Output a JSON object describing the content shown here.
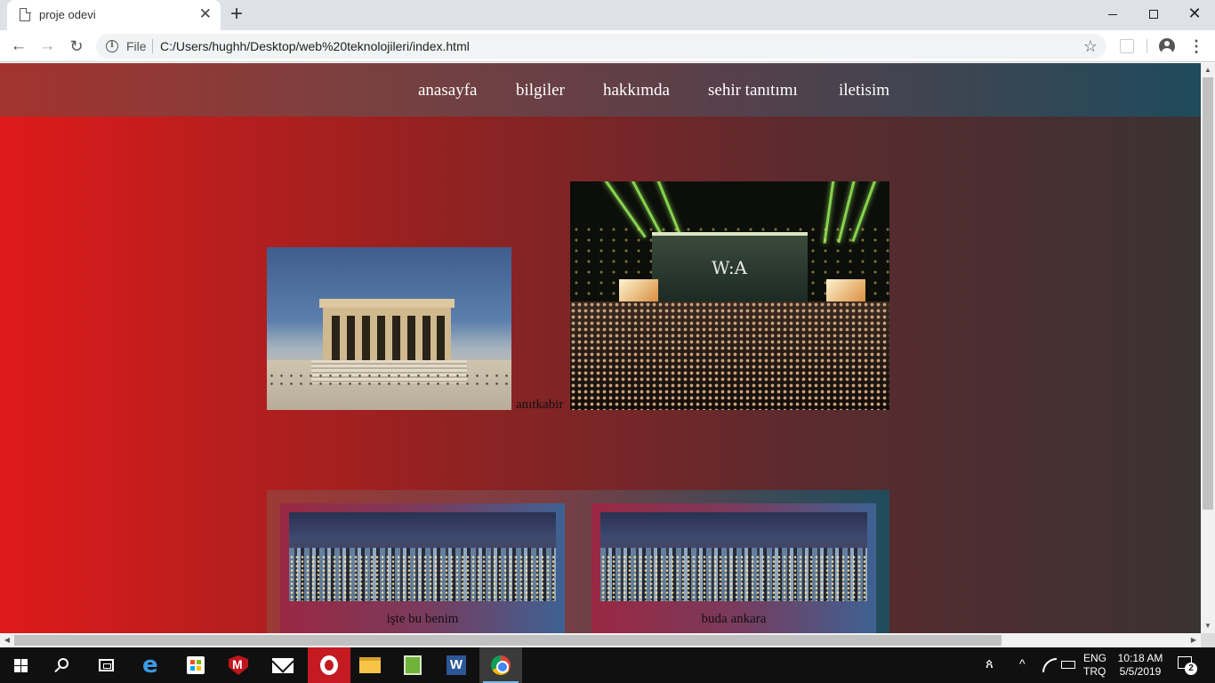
{
  "browser": {
    "tab_title": "proje odevi",
    "tab_close": "✕",
    "new_tab": "+",
    "address_prefix": "File",
    "url": "C:/Users/hughh/Desktop/web%20teknolojileri/index.html",
    "window_minimize_icon": "minimize-icon",
    "window_restore_icon": "restore-icon",
    "window_close": "✕",
    "back": "←",
    "forward": "→",
    "reload": "↻",
    "star": "☆",
    "menu": "⋮"
  },
  "site": {
    "nav": [
      {
        "label": "anasayfa"
      },
      {
        "label": "bilgiler"
      },
      {
        "label": "hakkımda"
      },
      {
        "label": "sehir tanıtımı"
      },
      {
        "label": "iletisim"
      }
    ],
    "hero": {
      "caption": "anıtkabir",
      "concert_logo": "W:A"
    },
    "cards": [
      {
        "caption": "işte bu benim"
      },
      {
        "caption": "buda ankara"
      }
    ],
    "colors": {
      "gradient_left": "#df1a1a",
      "gradient_right": "#3a3233",
      "nav_left": "#a3332e",
      "nav_right": "#1f4b5c"
    }
  },
  "taskbar": {
    "apps": [
      "start-icon",
      "search-icon",
      "task-view-icon",
      "edge-icon",
      "store-icon",
      "mcafee-icon",
      "mail-icon",
      "opera-icon",
      "file-explorer-icon",
      "notepad-icon",
      "word-icon",
      "chrome-icon"
    ],
    "word_letter": "W",
    "lang_line1": "ENG",
    "lang_line2": "TRQ",
    "time": "10:18 AM",
    "date": "5/5/2019",
    "notification_count": "2",
    "tray_chevron": "^"
  }
}
